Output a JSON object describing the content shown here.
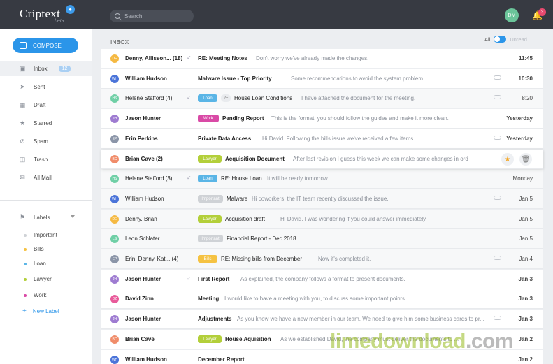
{
  "app": {
    "logo_text": "Criptext",
    "logo_sub": "beta",
    "logo_badge_icon": "lock-icon"
  },
  "topbar": {
    "search_placeholder": "Search",
    "avatar_initials": "DM",
    "notification_count": "3"
  },
  "sidebar": {
    "compose_label": "COMPOSE",
    "items": [
      {
        "label": "Inbox",
        "icon": "inbox-icon",
        "badge": "12",
        "active": true
      },
      {
        "label": "Sent",
        "icon": "send-icon"
      },
      {
        "label": "Draft",
        "icon": "draft-icon"
      },
      {
        "label": "Starred",
        "icon": "star-icon"
      },
      {
        "label": "Spam",
        "icon": "spam-icon"
      },
      {
        "label": "Trash",
        "icon": "trash-icon"
      },
      {
        "label": "All Mail",
        "icon": "all-mail-icon"
      }
    ],
    "labels_title": "Labels",
    "labels": [
      {
        "label": "Important",
        "color": "#cfd2d6"
      },
      {
        "label": "Bills",
        "color": "#f5c242"
      },
      {
        "label": "Loan",
        "color": "#5ab5e6"
      },
      {
        "label": "Lawyer",
        "color": "#b3cf3a"
      },
      {
        "label": "Work",
        "color": "#d94aa6"
      }
    ],
    "new_label": "New Label"
  },
  "main": {
    "title": "INBOX",
    "filter_all": "All",
    "filter_unread": "Unread"
  },
  "tag_colors": {
    "Loan": "#5ab5e6",
    "Work": "#d94aa6",
    "Lawyer": "#b3cf3a",
    "Important": "#cfd2d6",
    "Bills": "#f5c242"
  },
  "emails": [
    {
      "initials": "DE",
      "avatar_color": "#f5b942",
      "from": "Denny, Allisson... (18)",
      "replied": true,
      "tag": "",
      "extra": "",
      "subject": "RE: Meeting Notes",
      "preview": "Don't worry we've already made the changes.",
      "attachment": false,
      "date": "11:45",
      "unread": true
    },
    {
      "initials": "WH",
      "avatar_color": "#4b74d9",
      "from": "William Hudson",
      "replied": false,
      "tag": "",
      "extra": "",
      "subject": "Malware Issue - Top Priority",
      "preview": "Some recommendations to avoid the system problem.",
      "attachment": true,
      "date": "10:30",
      "unread": true
    },
    {
      "initials": "HS",
      "avatar_color": "#6fcfa6",
      "from": "Helene Stafford (4)",
      "replied": true,
      "tag": "Loan",
      "extra": "2+",
      "subject": "House Loan Conditions",
      "preview": "I have attached the document for the meeting.",
      "attachment": true,
      "date": "8:20",
      "unread": false
    },
    {
      "initials": "JH",
      "avatar_color": "#9e7bd1",
      "from": "Jason Hunter",
      "replied": false,
      "tag": "Work",
      "extra": "",
      "subject": "Pending Report",
      "preview": "This is the format, you should follow the guides and make it more clean.",
      "attachment": false,
      "date": "Yesterday",
      "unread": true
    },
    {
      "initials": "EP",
      "avatar_color": "#8b95a8",
      "from": "Erin Perkins",
      "replied": false,
      "tag": "",
      "extra": "",
      "subject": "Private Data Access",
      "preview": "Hi David. Following the bills issue we've received a few items.",
      "attachment": true,
      "date": "Yesterday",
      "unread": true
    },
    {
      "initials": "BC",
      "avatar_color": "#f08c6a",
      "from": "Brian Cave (2)",
      "replied": false,
      "tag": "Lawyer",
      "extra": "",
      "subject": "Acquisition Document",
      "preview": "After last revision I guess this week we can make some changes in order to ...",
      "attachment": false,
      "date": "",
      "unread": true,
      "hover": true
    },
    {
      "initials": "HS",
      "avatar_color": "#6fcfa6",
      "from": "Helene Stafford (3)",
      "replied": true,
      "tag": "Loan",
      "extra": "",
      "subject": "RE: House Loan",
      "preview": "It will be ready tomorrow.",
      "attachment": false,
      "date": "Monday",
      "unread": false
    },
    {
      "initials": "WH",
      "avatar_color": "#4b74d9",
      "from": "William Hudson",
      "replied": false,
      "tag": "Important",
      "extra": "",
      "subject": "Malware",
      "preview": "Hi coworkers, the IT team recently discussed the issue.",
      "attachment": true,
      "date": "Jan 5",
      "unread": false
    },
    {
      "initials": "DE",
      "avatar_color": "#f5b942",
      "from": "Denny, Brian",
      "replied": false,
      "tag": "Lawyer",
      "extra": "",
      "subject": "Acquisition draft",
      "preview": "Hi David, I was wondering if you could answer immediately.",
      "attachment": false,
      "date": "Jan 5",
      "unread": false
    },
    {
      "initials": "LS",
      "avatar_color": "#6fcfa6",
      "from": "Leon Schlater",
      "replied": false,
      "tag": "Important",
      "extra": "",
      "subject": "Financial Report - Dec 2018",
      "preview": "",
      "attachment": false,
      "date": "Jan 5",
      "unread": false
    },
    {
      "initials": "EP",
      "avatar_color": "#8b95a8",
      "from": "Erin, Denny, Kat... (4)",
      "replied": false,
      "tag": "Bills",
      "extra": "",
      "subject": "RE: Missing bills from December",
      "preview": "Now it's completed it.",
      "attachment": true,
      "date": "Jan 4",
      "unread": false
    },
    {
      "initials": "JH",
      "avatar_color": "#9e7bd1",
      "from": "Jason Hunter",
      "replied": true,
      "tag": "",
      "extra": "",
      "subject": "First Report",
      "preview": "As explained, the company follows a format to present documents.",
      "attachment": false,
      "date": "Jan 3",
      "unread": true
    },
    {
      "initials": "DZ",
      "avatar_color": "#e85a9a",
      "from": "David Zinn",
      "replied": false,
      "tag": "",
      "extra": "",
      "subject": "Meeting",
      "preview": "I would like to have a meeting with you, to discuss some important points.",
      "attachment": false,
      "date": "Jan 3",
      "unread": true
    },
    {
      "initials": "JH",
      "avatar_color": "#9e7bd1",
      "from": "Jason Hunter",
      "replied": false,
      "tag": "",
      "extra": "",
      "subject": "Adjustments",
      "preview": "As you know we have a new member in our team. We need to give him some business cards to pr...",
      "attachment": true,
      "date": "Jan 3",
      "unread": true
    },
    {
      "initials": "BC",
      "avatar_color": "#f08c6a",
      "from": "Brian Cave",
      "replied": false,
      "tag": "Lawyer",
      "extra": "",
      "subject": "House Aquisition",
      "preview": "As we established David, the company must deliver the documents to ...",
      "attachment": false,
      "date": "Jan 2",
      "unread": true
    },
    {
      "initials": "WH",
      "avatar_color": "#4b74d9",
      "from": "William Hudson",
      "replied": false,
      "tag": "",
      "extra": "",
      "subject": "December Report",
      "preview": "",
      "attachment": false,
      "date": "Jan 2",
      "unread": true
    }
  ],
  "watermark": {
    "part1": "lime",
    "part2": "download",
    "part3": ".com"
  }
}
